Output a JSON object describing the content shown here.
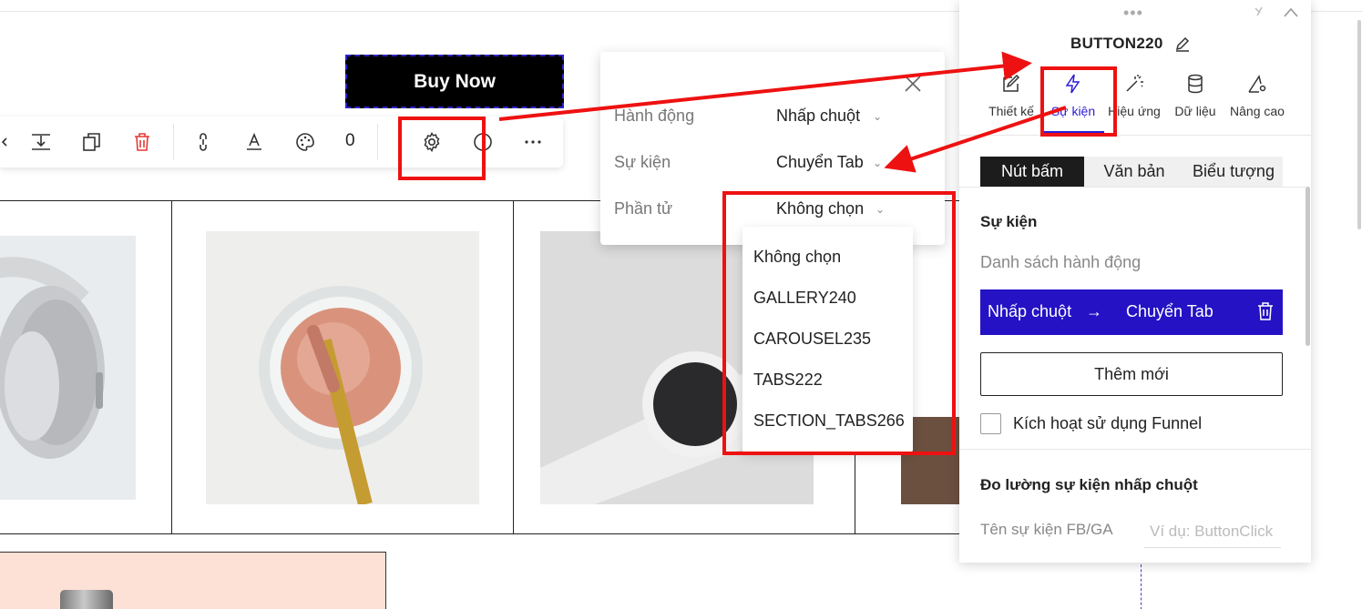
{
  "canvas": {
    "buy_now_label": "Buy Now",
    "toolbar_count": "0"
  },
  "event_popup": {
    "rows": [
      {
        "label": "Hành động",
        "value": "Nhấp chuột"
      },
      {
        "label": "Sự kiện",
        "value": "Chuyển Tab"
      },
      {
        "label": "Phần tử",
        "value": "Không chọn"
      }
    ],
    "dropdown_options": [
      "Không chọn",
      "GALLERY240",
      "CAROUSEL235",
      "TABS222",
      "SECTION_TABS266"
    ]
  },
  "panel": {
    "title": "BUTTON220",
    "tabs": [
      {
        "label": "Thiết kế",
        "icon": "pencil-square-icon"
      },
      {
        "label": "Sự kiện",
        "icon": "lightning-icon"
      },
      {
        "label": "Hiệu ứng",
        "icon": "magic-wand-icon"
      },
      {
        "label": "Dữ liệu",
        "icon": "database-icon"
      },
      {
        "label": "Nâng cao",
        "icon": "advanced-settings-icon"
      }
    ],
    "active_tab": "Sự kiện",
    "segments": [
      "Nút bấm",
      "Văn bản",
      "Biểu tượng"
    ],
    "active_segment": "Nút bấm",
    "event_section": {
      "title": "Sự kiện",
      "subtitle": "Danh sách hành động",
      "action": {
        "trigger": "Nhấp chuột",
        "arrow": "→",
        "result": "Chuyển Tab"
      },
      "add_label": "Thêm mới",
      "funnel_label": "Kích hoạt sử dụng Funnel",
      "funnel_checked": false
    },
    "tracking_section": {
      "title": "Đo lường sự kiện nhấp chuột",
      "field_label": "Tên sự kiện FB/GA",
      "field_value": "",
      "field_placeholder": "Ví dụ: ButtonClick"
    }
  },
  "colors": {
    "accent": "#2412c4",
    "annotation_red": "#ee1111",
    "delete_red": "#e53935"
  }
}
